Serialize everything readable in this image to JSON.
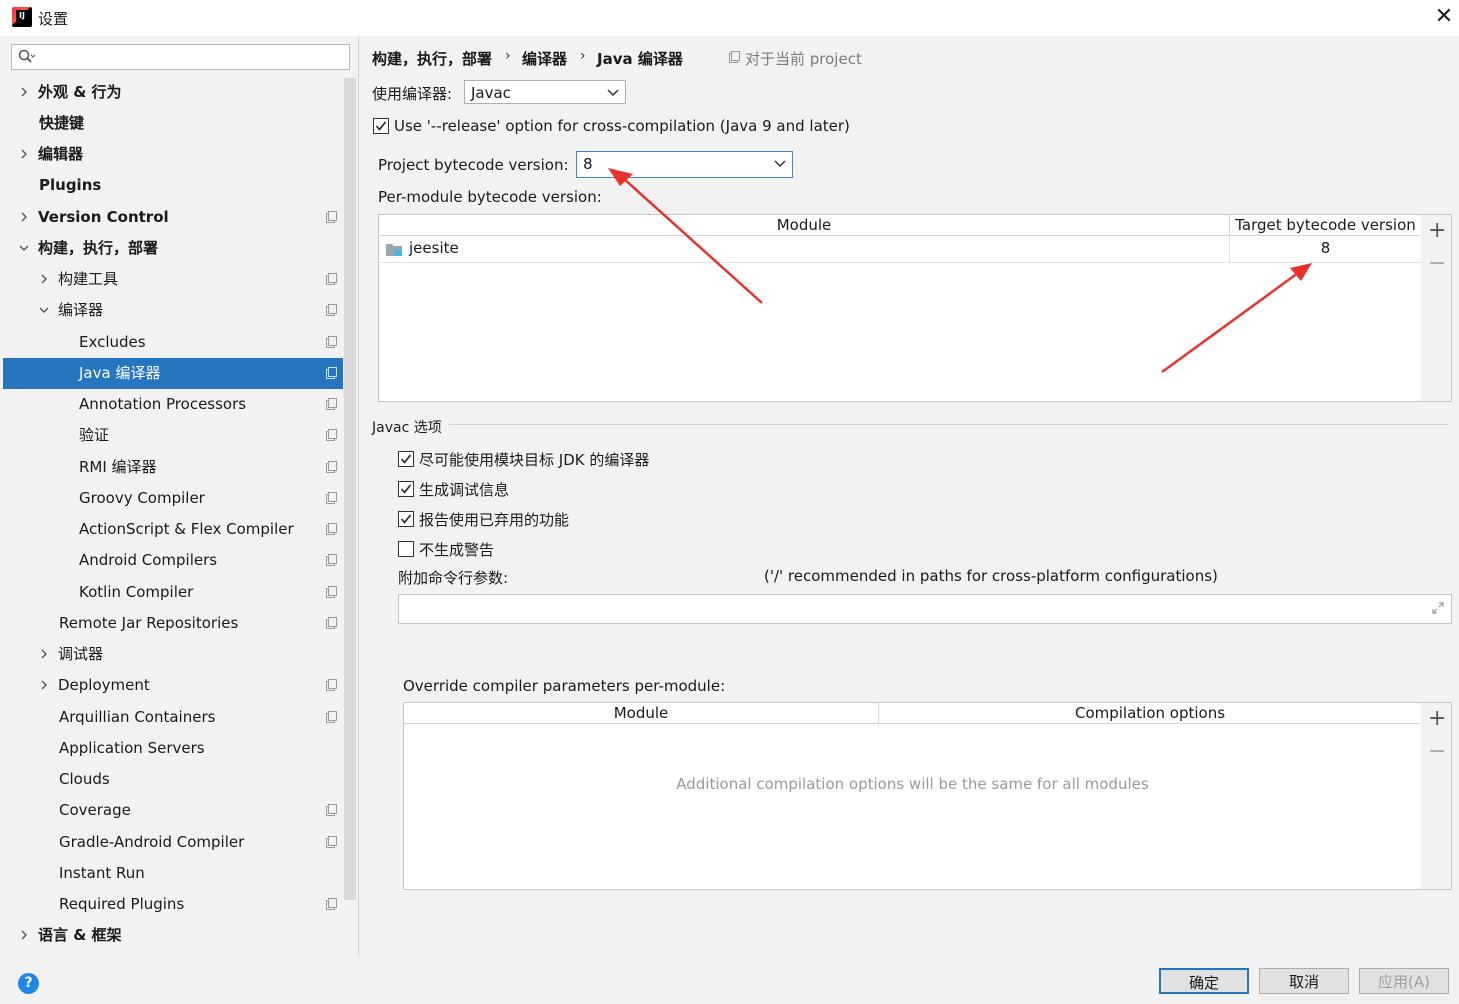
{
  "window": {
    "title": "设置"
  },
  "search": {
    "placeholder": ""
  },
  "sidebar": {
    "items": [
      {
        "label": "外观 & 行为"
      },
      {
        "label": "快捷键"
      },
      {
        "label": "编辑器"
      },
      {
        "label": "Plugins"
      },
      {
        "label": "Version Control"
      },
      {
        "label": "构建，执行，部署"
      },
      {
        "label": "构建工具"
      },
      {
        "label": "编译器"
      },
      {
        "label": "Excludes"
      },
      {
        "label": "Java 编译器"
      },
      {
        "label": "Annotation Processors"
      },
      {
        "label": "验证"
      },
      {
        "label": "RMI 编译器"
      },
      {
        "label": "Groovy Compiler"
      },
      {
        "label": "ActionScript & Flex Compiler"
      },
      {
        "label": "Android Compilers"
      },
      {
        "label": "Kotlin Compiler"
      },
      {
        "label": "Remote Jar Repositories"
      },
      {
        "label": "调试器"
      },
      {
        "label": "Deployment"
      },
      {
        "label": "Arquillian Containers"
      },
      {
        "label": "Application Servers"
      },
      {
        "label": "Clouds"
      },
      {
        "label": "Coverage"
      },
      {
        "label": "Gradle-Android Compiler"
      },
      {
        "label": "Instant Run"
      },
      {
        "label": "Required Plugins"
      },
      {
        "label": "语言 & 框架"
      }
    ]
  },
  "breadcrumb": {
    "items": [
      "构建，执行，部署",
      "编译器",
      "Java 编译器"
    ],
    "separator": "›",
    "project_note": "对于当前 project"
  },
  "compiler": {
    "label": "使用编译器:",
    "value": "Javac"
  },
  "release_option": {
    "label": "Use '--release' option for cross-compilation (Java 9 and later)",
    "checked": true
  },
  "bytecode": {
    "label": "Project bytecode version:",
    "value": "8",
    "per_module_label": "Per-module bytecode version:"
  },
  "module_table": {
    "headers": [
      "Module",
      "Target bytecode version"
    ],
    "rows": [
      {
        "module": "jeesite",
        "version": "8"
      }
    ]
  },
  "javac": {
    "section_title": "Javac 选项",
    "options": [
      {
        "label": "尽可能使用模块目标 JDK 的编译器",
        "checked": true
      },
      {
        "label": "生成调试信息",
        "checked": true
      },
      {
        "label": "报告使用已弃用的功能",
        "checked": true
      },
      {
        "label": "不生成警告",
        "checked": false
      }
    ],
    "cmd_label": "附加命令行参数:",
    "cmd_hint": "('/' recommended in paths for cross-platform configurations)",
    "cmd_value": ""
  },
  "override": {
    "label": "Override compiler parameters per-module:",
    "headers": [
      "Module",
      "Compilation options"
    ],
    "empty_text": "Additional compilation options will be the same for all modules"
  },
  "buttons": {
    "ok": "确定",
    "cancel": "取消",
    "apply": "应用(A)"
  },
  "colors": {
    "selection": "#2675bf",
    "annotation_arrow": "#e8312a"
  }
}
